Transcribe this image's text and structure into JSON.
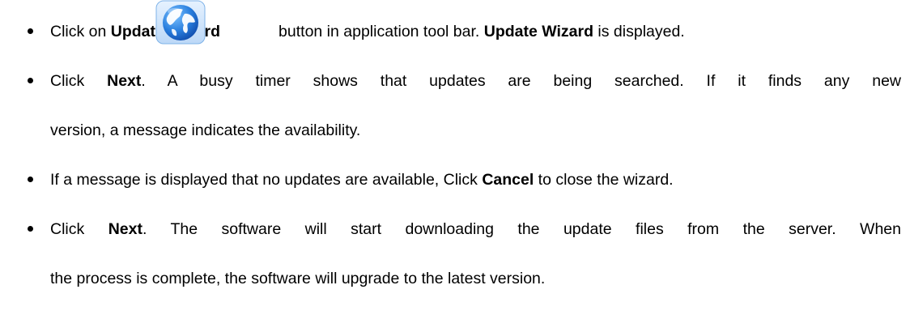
{
  "doc": {
    "items": [
      {
        "pre": "Click on ",
        "bold1": "Update Wizard",
        "mid": "button in application tool bar. ",
        "bold2": "Update Wizard",
        "post": " is displayed.",
        "icon": "update-wizard-globe-icon"
      },
      {
        "line1_pre": "Click ",
        "line1_bold": "Next",
        "line1_post": ". A busy timer shows that updates are being searched. If it finds any new",
        "line2": "version, a message indicates the availability."
      },
      {
        "pre": "If a message is displayed that no updates are available, Click ",
        "bold": "Cancel",
        "post": " to close the wizard."
      },
      {
        "line1_pre": "Click ",
        "line1_bold": "Next",
        "line1_post": ". The software will start downloading the update files from the server. When",
        "line2": "the process is complete, the software will upgrade to the latest version."
      }
    ]
  },
  "colors": {
    "text": "#000000",
    "background": "#ffffff",
    "globe_blue": "#1e6fd0",
    "globe_land": "#ffffff"
  }
}
